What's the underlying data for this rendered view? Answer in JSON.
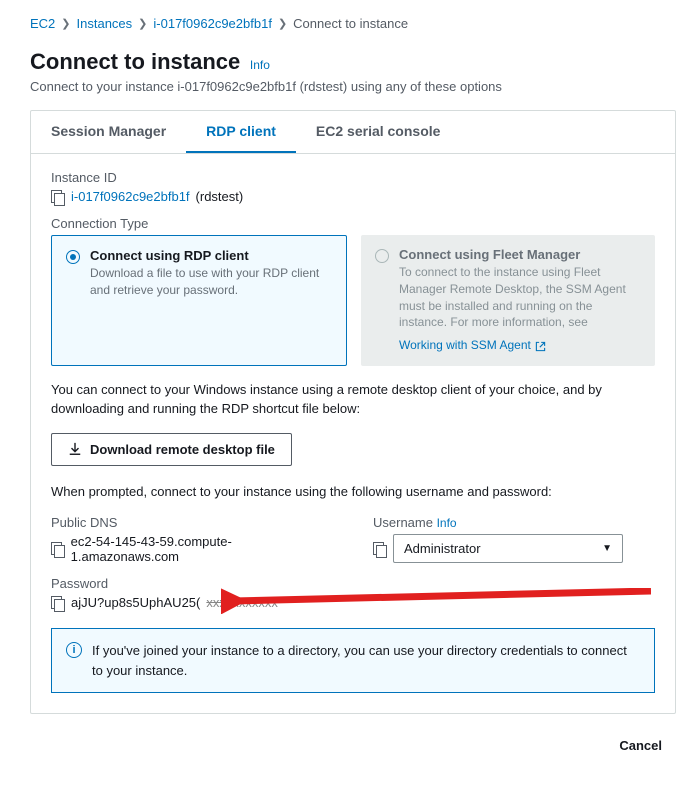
{
  "breadcrumb": {
    "items": [
      "EC2",
      "Instances",
      "i-017f0962c9e2bfb1f"
    ],
    "current": "Connect to instance"
  },
  "header": {
    "title": "Connect to instance",
    "info": "Info",
    "subtitle": "Connect to your instance i-017f0962c9e2bfb1f (rdstest) using any of these options"
  },
  "tabs": {
    "items": [
      "Session Manager",
      "RDP client",
      "EC2 serial console"
    ],
    "active": "RDP client"
  },
  "instance": {
    "label": "Instance ID",
    "id": "i-017f0962c9e2bfb1f",
    "name_suffix": "(rdstest)"
  },
  "connection": {
    "label": "Connection Type",
    "rdp": {
      "title": "Connect using RDP client",
      "desc": "Download a file to use with your RDP client and retrieve your password."
    },
    "fleet": {
      "title": "Connect using Fleet Manager",
      "desc": "To connect to the instance using Fleet Manager Remote Desktop, the SSM Agent must be installed and running on the instance. For more information, see ",
      "link": "Working with SSM Agent"
    }
  },
  "desc1": "You can connect to your Windows instance using a remote desktop client of your choice, and by downloading and running the RDP shortcut file below:",
  "download_btn": "Download remote desktop file",
  "desc2": "When prompted, connect to your instance using the following username and password:",
  "dns": {
    "label": "Public DNS",
    "value": "ec2-54-145-43-59.compute-1.amazonaws.com"
  },
  "username": {
    "label": "Username",
    "info": "Info",
    "value": "Administrator"
  },
  "password": {
    "label": "Password",
    "value_visible": "ajJU?up8s5UphAU25(",
    "value_hidden": "xxxxxxxxxxx"
  },
  "info_box": "If you've joined your instance to a directory, you can use your directory credentials to connect to your instance.",
  "footer": {
    "cancel": "Cancel"
  }
}
